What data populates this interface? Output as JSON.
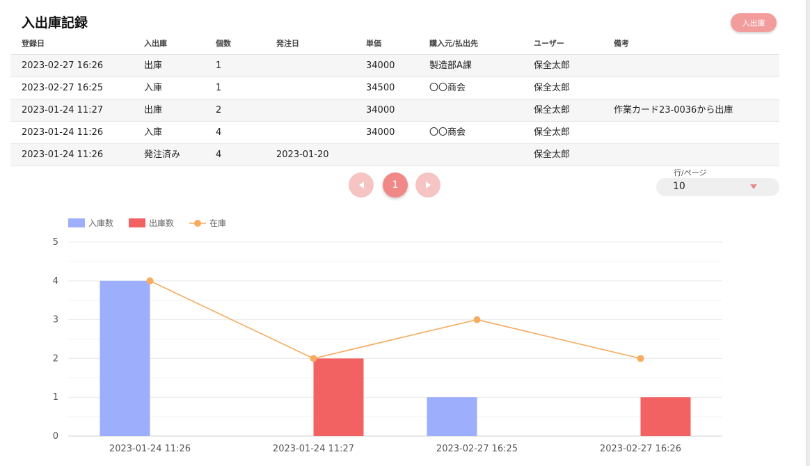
{
  "page": {
    "title": "入出庫記録",
    "action_button": "入出庫"
  },
  "table": {
    "headers": [
      "登録日",
      "入出庫",
      "個数",
      "発注日",
      "単価",
      "購入元/払出先",
      "ユーザー",
      "備考"
    ],
    "rows": [
      [
        "2023-02-27 16:26",
        "出庫",
        "1",
        "",
        "34000",
        "製造部A課",
        "保全太郎",
        ""
      ],
      [
        "2023-02-27 16:25",
        "入庫",
        "1",
        "",
        "34500",
        "〇〇商会",
        "保全太郎",
        ""
      ],
      [
        "2023-01-24 11:27",
        "出庫",
        "2",
        "",
        "34000",
        "",
        "保全太郎",
        "作業カード23-0036から出庫"
      ],
      [
        "2023-01-24 11:26",
        "入庫",
        "4",
        "",
        "34000",
        "〇〇商会",
        "保全太郎",
        ""
      ],
      [
        "2023-01-24 11:26",
        "発注済み",
        "4",
        "2023-01-20",
        "",
        "",
        "保全太郎",
        ""
      ]
    ]
  },
  "pagination": {
    "current_page": "1",
    "rows_per_page_label": "行/ページ",
    "rows_per_page_value": "10",
    "icons": [
      "prev-page-icon",
      "next-page-icon",
      "dropdown-caret-icon"
    ]
  },
  "chart_data": {
    "type": "bar",
    "categories": [
      "2023-01-24 11:26",
      "2023-01-24 11:27",
      "2023-02-27 16:25",
      "2023-02-27 16:26"
    ],
    "series": [
      {
        "name": "入庫数",
        "type": "bar",
        "color": "#9daefc",
        "values": [
          4,
          0,
          1,
          0
        ]
      },
      {
        "name": "出庫数",
        "type": "bar",
        "color": "#f26262",
        "values": [
          0,
          2,
          0,
          1
        ]
      },
      {
        "name": "在庫",
        "type": "line",
        "color": "#f6ab5e",
        "values": [
          4,
          2,
          3,
          2
        ]
      }
    ],
    "ylim": [
      0,
      5
    ],
    "yticks": [
      0,
      1,
      2,
      3,
      4,
      5
    ],
    "grid": true,
    "legend": "top-left"
  }
}
